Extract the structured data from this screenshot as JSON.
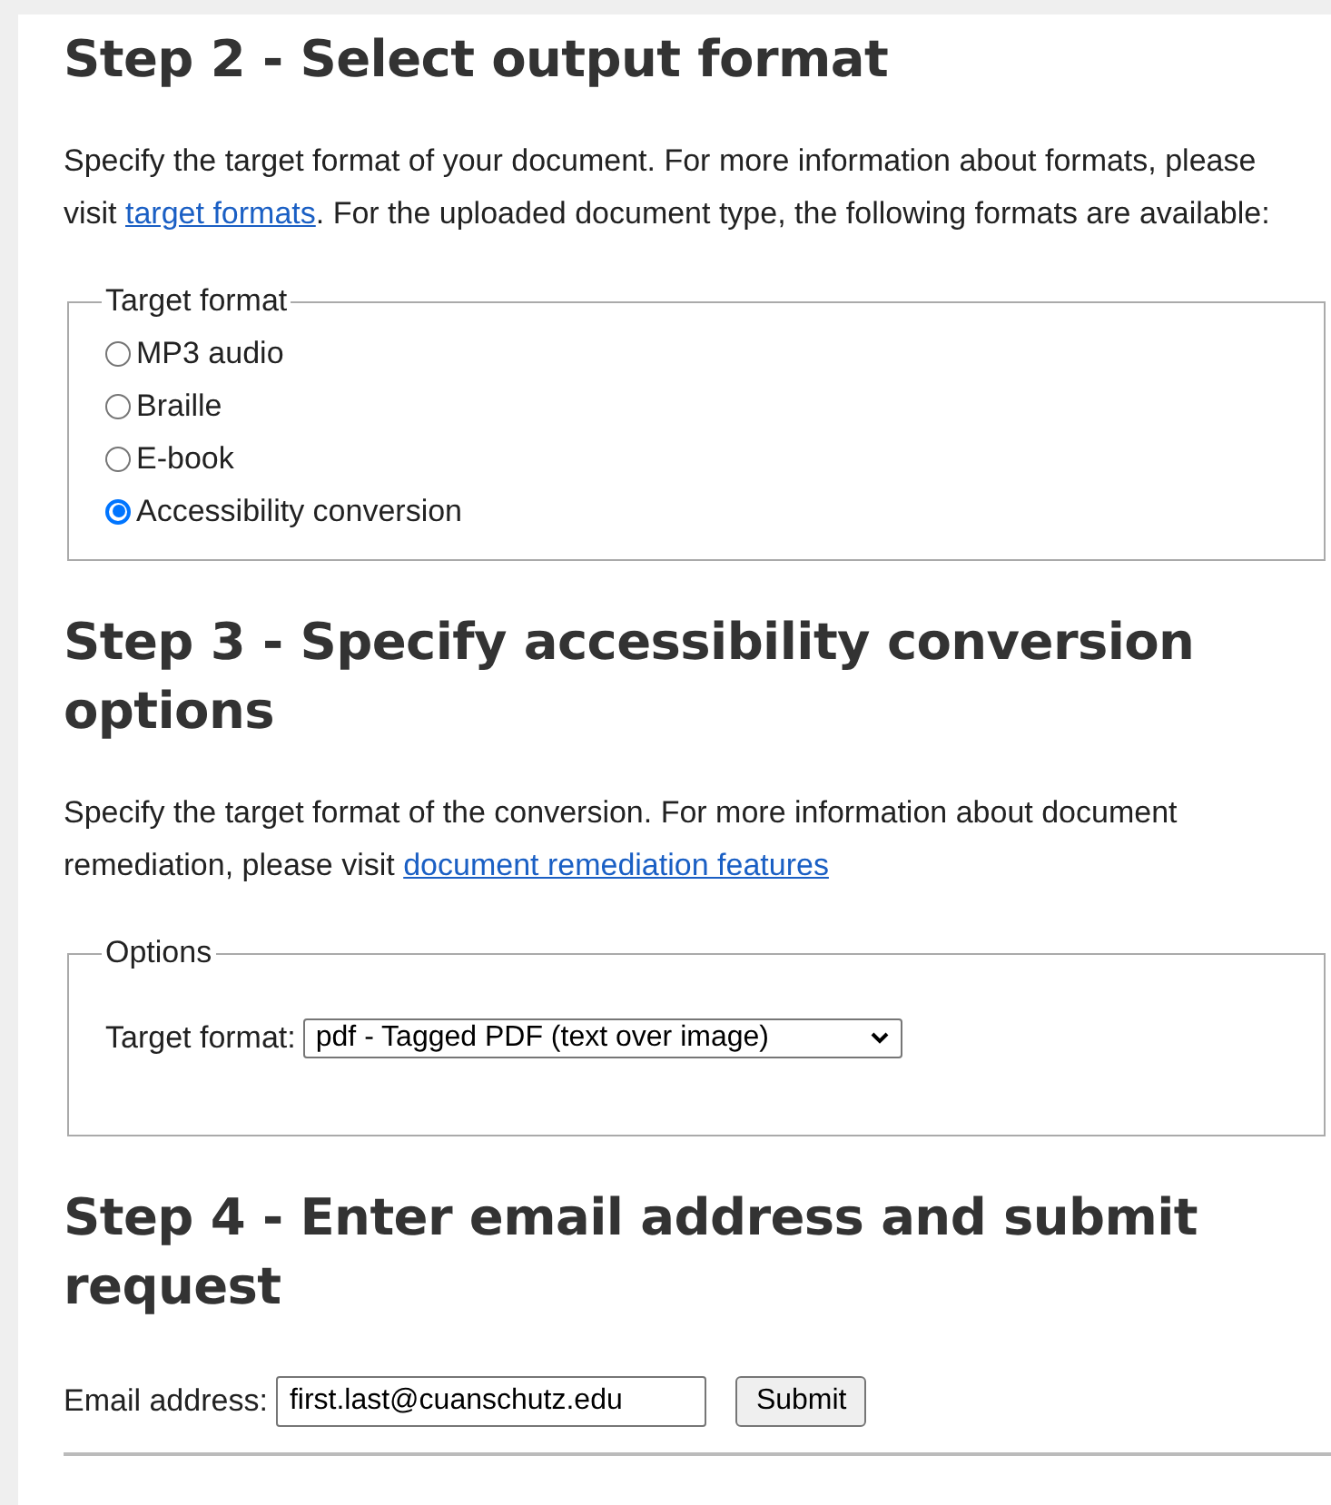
{
  "steps": [
    {
      "heading": "Step 2 - Select output format",
      "intro": {
        "before": "Specify the target format of your document. For more information about formats, please visit ",
        "link": "target formats",
        "after": ". For the uploaded document type, the following formats are available:"
      },
      "kind": "radios",
      "legend": "Target format",
      "options": [
        {
          "label": "MP3 audio",
          "selected": false
        },
        {
          "label": "Braille",
          "selected": false
        },
        {
          "label": "E-book",
          "selected": false
        },
        {
          "label": "Accessibility conversion",
          "selected": true
        }
      ]
    },
    {
      "heading": "Step 3 - Specify accessibility conversion options",
      "intro": {
        "before": "Specify the target format of the conversion. For more information about document remediation, please visit ",
        "link": "document remediation features"
      },
      "kind": "select",
      "legend": "Options",
      "label": "Target format:",
      "value": "pdf - Tagged PDF (text over image)"
    },
    {
      "heading": "Step 4 - Enter email address and submit request",
      "kind": "email",
      "label": "Email address:",
      "value": "first.last@cuanschutz.edu",
      "button": "Submit"
    }
  ]
}
